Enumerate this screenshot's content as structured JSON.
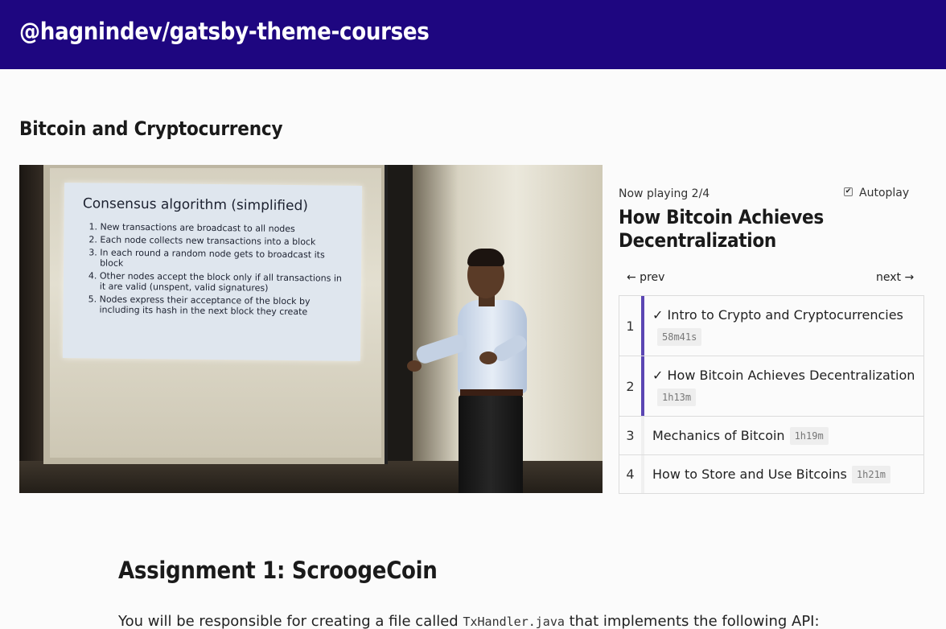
{
  "site": {
    "title": "@hagnindev/gatsby-theme-courses"
  },
  "course": {
    "title": "Bitcoin and Cryptocurrency"
  },
  "video": {
    "slide": {
      "title": "Consensus algorithm (simplified)",
      "items": [
        "New transactions are broadcast to all nodes",
        "Each node collects new transactions into a block",
        "In each round a random node gets to broadcast its block",
        "Other nodes accept the block only if all transactions in it are valid (unspent, valid signatures)",
        "Nodes express their acceptance of the block by including its hash in the next block they create"
      ]
    }
  },
  "player": {
    "now_playing": "Now playing 2/4",
    "autoplay_label": "Autoplay",
    "autoplay_checked": true,
    "current_title": "How Bitcoin Achieves Decentralization",
    "prev_label": "← prev",
    "next_label": "next →"
  },
  "playlist": [
    {
      "num": "1",
      "title": "✓ Intro to Crypto and Cryptocurrencies",
      "duration": "58m41s",
      "done": true
    },
    {
      "num": "2",
      "title": "✓ How Bitcoin Achieves Decentralization",
      "duration": "1h13m",
      "done": true
    },
    {
      "num": "3",
      "title": "Mechanics of Bitcoin",
      "duration": "1h19m",
      "done": false
    },
    {
      "num": "4",
      "title": "How to Store and Use Bitcoins",
      "duration": "1h21m",
      "done": false
    }
  ],
  "assignment": {
    "title": "Assignment 1: ScroogeCoin",
    "text_before": "You will be responsible for creating a file called ",
    "code": "TxHandler.java",
    "text_after": " that implements the following API:"
  },
  "colors": {
    "header_bg": "#1e0680",
    "accent": "#5b46b3"
  }
}
